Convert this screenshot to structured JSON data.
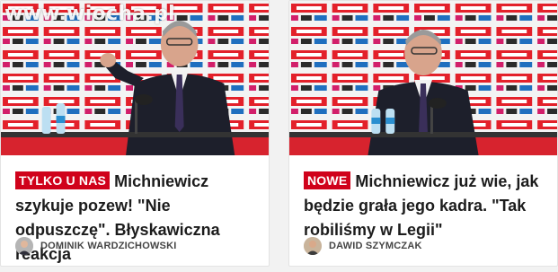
{
  "watermark": "www.wiocha.pl",
  "cards": [
    {
      "badge": "TYLKO U NAS",
      "title": "Michniewicz szykuje pozew! \"Nie odpuszczę\". Błyskawiczna reakcja",
      "author": "DOMINIK WARDZICHOWSKI",
      "photo_alt": "Michniewicz at press conference gesturing"
    },
    {
      "badge": "NOWE",
      "title": "Michniewicz już wie, jak będzie grała jego kadra. \"Tak robiliśmy w Legii\"",
      "author": "DAWID SZYMCZAK",
      "photo_alt": "Michniewicz at press conference"
    }
  ],
  "colors": {
    "badge": "#d0021b",
    "lotos_red": "#e3202a",
    "backdrop": "#f4f4f4",
    "suit": "#1d1f2b"
  }
}
